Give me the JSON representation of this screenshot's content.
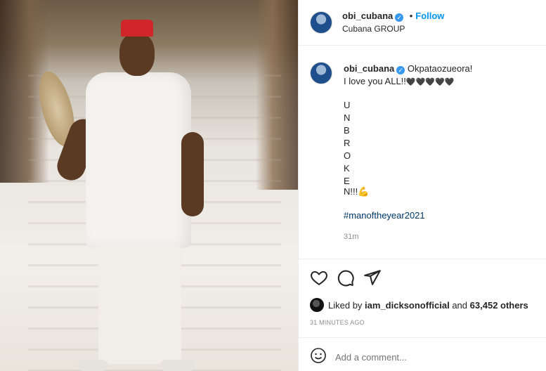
{
  "post": {
    "username": "obi_cubana",
    "verified": true,
    "follow_label": "Follow",
    "location": "Cubana GROUP",
    "caption_first": "Okpataozueora!",
    "caption_second": "I love you ALL!!",
    "hearts": "🖤🖤🖤🖤🖤",
    "unbroken_letters": [
      "U",
      "N",
      "B",
      "R",
      "O",
      "K",
      "E"
    ],
    "unbroken_last": "N!!!",
    "flex_emoji": "💪",
    "hashtag": "#manoftheyear2021",
    "caption_time": "31m",
    "liked_prefix": "Liked by",
    "liked_user": "iam_dicksonofficial",
    "liked_and": "and",
    "liked_count": "63,452 others",
    "timestamp": "31 MINUTES AGO",
    "comment_placeholder": "Add a comment..."
  },
  "colors": {
    "accent": "#0095f6",
    "verified": "#3897f0",
    "hat": "#d0262a"
  },
  "icons": [
    "verified-badge-icon",
    "heart-icon",
    "comment-icon",
    "share-icon",
    "emoji-icon"
  ]
}
